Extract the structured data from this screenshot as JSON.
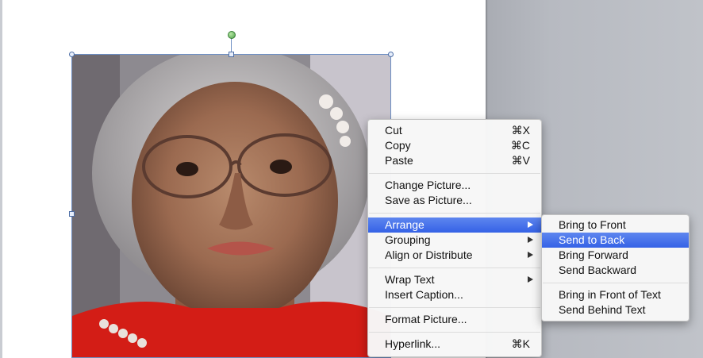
{
  "context_menu": {
    "groups": [
      [
        {
          "label": "Cut",
          "shortcut": "⌘X"
        },
        {
          "label": "Copy",
          "shortcut": "⌘C"
        },
        {
          "label": "Paste",
          "shortcut": "⌘V"
        }
      ],
      [
        {
          "label": "Change Picture..."
        },
        {
          "label": "Save as Picture..."
        }
      ],
      [
        {
          "label": "Arrange",
          "submenu": true,
          "highlighted": true
        },
        {
          "label": "Grouping",
          "submenu": true
        },
        {
          "label": "Align or Distribute",
          "submenu": true
        }
      ],
      [
        {
          "label": "Wrap Text",
          "submenu": true
        },
        {
          "label": "Insert Caption..."
        }
      ],
      [
        {
          "label": "Format Picture..."
        }
      ],
      [
        {
          "label": "Hyperlink...",
          "shortcut": "⌘K"
        }
      ]
    ]
  },
  "arrange_submenu": {
    "groups": [
      [
        {
          "label": "Bring to Front"
        },
        {
          "label": "Send to Back",
          "highlighted": true
        },
        {
          "label": "Bring Forward"
        },
        {
          "label": "Send Backward"
        }
      ],
      [
        {
          "label": "Bring in Front of Text"
        },
        {
          "label": "Send Behind Text"
        }
      ]
    ]
  },
  "colors": {
    "highlight": "#3a66e7",
    "selection_border": "#6d8fc4",
    "rotation_handle": "#4fa24a"
  }
}
